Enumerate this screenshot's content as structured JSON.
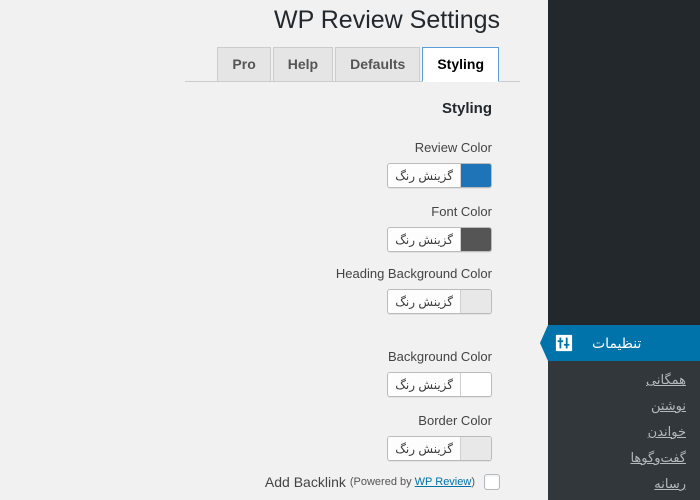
{
  "page": {
    "title": "WP Review Settings",
    "section_heading": "Styling"
  },
  "tabs": [
    {
      "label": "Pro",
      "active": false
    },
    {
      "label": "Help",
      "active": false
    },
    {
      "label": "Defaults",
      "active": false
    },
    {
      "label": "Styling",
      "active": true
    }
  ],
  "picker_button_label": "گزینش رنگ",
  "fields": [
    {
      "label": "Review Color",
      "swatch": "#1f73b7"
    },
    {
      "label": "Font Color",
      "swatch": "#555555"
    },
    {
      "label": "Heading Background Color",
      "swatch": "#e8e8e8"
    },
    {
      "label": "Background Color",
      "swatch": "#ffffff"
    },
    {
      "label": "Border Color",
      "swatch": "#e8e8e8"
    }
  ],
  "backlink": {
    "label": "Add Backlink",
    "powered_prefix": "(Powered by ",
    "link_text": "WP Review",
    "powered_suffix": ")",
    "checked": false
  },
  "sidebar": {
    "current_item": {
      "label": "تنظیمات",
      "icon": "settings-sliders-icon"
    },
    "submenu": [
      {
        "label": "همگانی"
      },
      {
        "label": "نوشتن"
      },
      {
        "label": "خواندن"
      },
      {
        "label": "گفت‌وگوها"
      },
      {
        "label": "رسانه"
      }
    ]
  },
  "colors": {
    "admin_blue": "#0073aa",
    "admin_dark": "#23282d",
    "admin_submenu": "#32373c",
    "content_bg": "#f1f1f1",
    "tab_active_border": "#5b9dd9",
    "link": "#0073aa"
  }
}
